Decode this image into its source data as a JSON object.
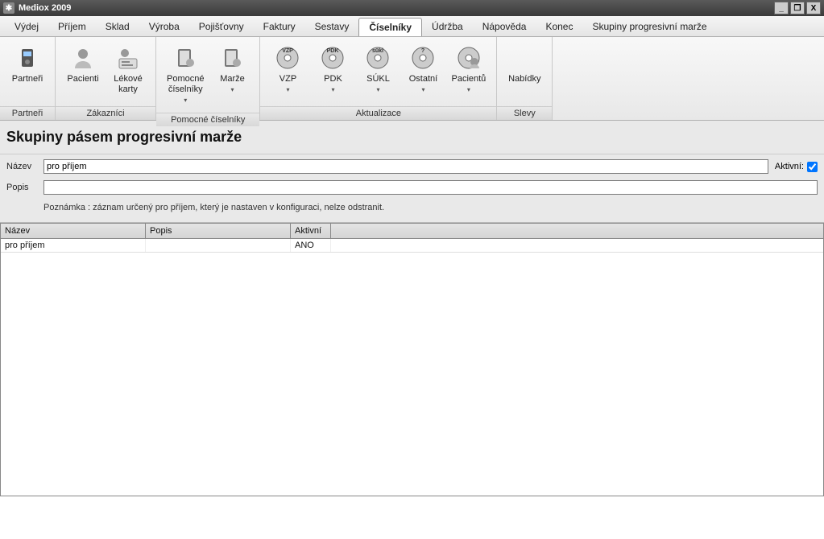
{
  "app": {
    "title": "Mediox 2009"
  },
  "window_buttons": {
    "min": "_",
    "max": "❐",
    "close": "X"
  },
  "menu": {
    "items": [
      "Výdej",
      "Příjem",
      "Sklad",
      "Výroba",
      "Pojišťovny",
      "Faktury",
      "Sestavy",
      "Číselníky",
      "Údržba",
      "Nápověda",
      "Konec",
      "Skupiny progresivní marže"
    ],
    "active_index": 7
  },
  "ribbon": {
    "groups": [
      {
        "title": "Partneři",
        "buttons": [
          {
            "label": "Partneři",
            "icon": "partners"
          }
        ]
      },
      {
        "title": "Zákazníci",
        "buttons": [
          {
            "label": "Pacienti",
            "icon": "patient"
          },
          {
            "label": "Lékové karty",
            "icon": "card"
          }
        ]
      },
      {
        "title": "Pomocné číselníky",
        "buttons": [
          {
            "label": "Pomocné číselníky",
            "icon": "book",
            "dropdown": true
          },
          {
            "label": "Marže",
            "icon": "book",
            "dropdown": true
          }
        ]
      },
      {
        "title": "Aktualizace",
        "buttons": [
          {
            "label": "VZP",
            "icon": "disc-vzp",
            "dropdown": true
          },
          {
            "label": "PDK",
            "icon": "disc-pdk",
            "dropdown": true
          },
          {
            "label": "SÚKL",
            "icon": "disc-sukl",
            "dropdown": true
          },
          {
            "label": "Ostatní",
            "icon": "disc-other",
            "dropdown": true
          },
          {
            "label": "Pacientů",
            "icon": "disc-patient",
            "dropdown": true
          }
        ]
      },
      {
        "title": "Slevy",
        "buttons": [
          {
            "label": "Nabídky",
            "icon": "none"
          }
        ]
      }
    ]
  },
  "page": {
    "title": "Skupiny pásem progresivní marže",
    "form": {
      "nazev_label": "Název",
      "nazev_value": "pro příjem",
      "popis_label": "Popis",
      "popis_value": "",
      "aktivni_label": "Aktivní:",
      "aktivni_checked": true,
      "note": "Poznámka : záznam určený pro příjem, který je nastaven v konfiguraci, nelze odstranit."
    },
    "grid": {
      "headers": {
        "nazev": "Název",
        "popis": "Popis",
        "aktivni": "Aktivní"
      },
      "rows": [
        {
          "nazev": "pro příjem",
          "popis": "",
          "aktivni": "ANO"
        }
      ]
    }
  }
}
